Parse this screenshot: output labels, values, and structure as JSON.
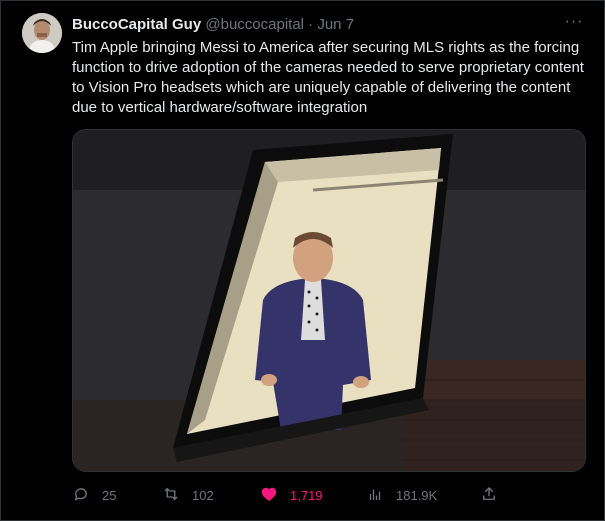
{
  "tweet": {
    "author_name": "BuccoCapital Guy",
    "author_handle": "@buccocapital",
    "separator": "·",
    "date": "Jun 7",
    "text": "Tim Apple bringing Messi to America after securing MLS rights as the forcing function to drive adoption of the cameras needed to serve proprietary content to Vision Pro headsets which are uniquely capable of delivering the content due to vertical hardware/software integration",
    "media_description_icon": "photo",
    "replies": "25",
    "retweets": "102",
    "likes": "1,719",
    "views": "181.9K"
  },
  "colors": {
    "background": "#000000",
    "text": "#e7e9ea",
    "muted": "#71767b",
    "like": "#f91880"
  },
  "icons": [
    "more-icon",
    "reply-icon",
    "retweet-icon",
    "like-icon",
    "views-icon",
    "share-icon"
  ]
}
